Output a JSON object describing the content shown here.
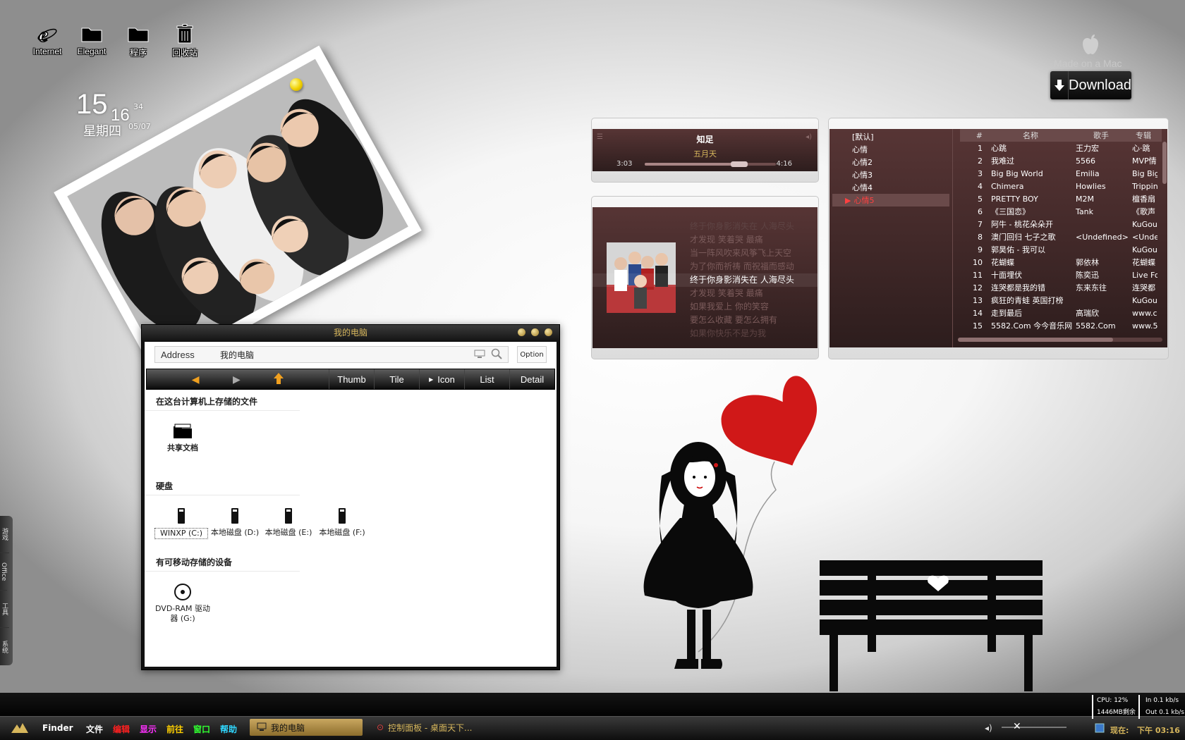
{
  "desktop": {
    "icons": [
      {
        "label": "Internet",
        "icon": "ie-icon"
      },
      {
        "label": "Elegant",
        "icon": "folder-icon"
      },
      {
        "label": "程序",
        "icon": "folder-icon"
      },
      {
        "label": "回收站",
        "icon": "recycle-bin-icon"
      }
    ]
  },
  "clock": {
    "hour": "15",
    "minute": "16",
    "second": "34",
    "weekday": "星期四",
    "date": "05/07"
  },
  "mac_badge": {
    "text": "Made on a Mac",
    "icon": "apple-icon"
  },
  "download": {
    "label": "Download",
    "icon": "download-arrow-icon"
  },
  "explorer": {
    "title": "我的电脑",
    "address_label": "Address",
    "address_value": "我的电脑",
    "option_label": "Option",
    "views": [
      "Thumb",
      "Tile",
      "Icon",
      "List",
      "Detail"
    ],
    "sections": [
      {
        "title": "在这台计算机上存储的文件",
        "items": [
          {
            "label": "共享文档",
            "icon": "folder-icon"
          }
        ]
      },
      {
        "title": "硬盘",
        "items": [
          {
            "label": "WINXP (C:)",
            "icon": "hard-disk-icon"
          },
          {
            "label": "本地磁盘 (D:)",
            "icon": "hard-disk-icon"
          },
          {
            "label": "本地磁盘 (E:)",
            "icon": "hard-disk-icon"
          },
          {
            "label": "本地磁盘 (F:)",
            "icon": "hard-disk-icon"
          }
        ]
      },
      {
        "title": "有可移动存储的设备",
        "items": [
          {
            "label": "DVD-RAM 驱动器 (G:)",
            "icon": "dvd-drive-icon"
          }
        ]
      }
    ]
  },
  "player": {
    "song": "知足",
    "artist": "五月天",
    "elapsed": "3:03",
    "total": "4:16",
    "progress": 0.72,
    "lyrics": [
      "终于你身影消失在  人海尽头",
      "才发现  笑着哭  最痛",
      "当一阵风吹来风筝飞上天空",
      "为了你而祈祷  而祝福而感动",
      "终于你身影消失在  人海尽头",
      "才发现  笑着哭  最痛",
      "如果我爱上  你的笑容",
      "要怎么收藏  要怎么拥有",
      "如果你快乐不是为我"
    ],
    "current_lyric_index": 4
  },
  "playlist": {
    "groups": [
      "[默认]",
      "心情",
      "心情2",
      "心情3",
      "心情4",
      "心情5"
    ],
    "active_group": 5,
    "columns": [
      "#",
      "名称",
      "歌手",
      "专辑"
    ],
    "rows": [
      [
        "1",
        "心跳",
        "王力宏",
        "心·跳"
      ],
      [
        "2",
        "我难过",
        "5566",
        "MVP情"
      ],
      [
        "3",
        "Big Big World",
        "Emilia",
        "Big Big"
      ],
      [
        "4",
        "Chimera",
        "Howlies",
        "Trippin"
      ],
      [
        "5",
        "PRETTY BOY",
        "M2M",
        "檀香扇"
      ],
      [
        "6",
        "《三国恋》",
        "Tank",
        "《歌声"
      ],
      [
        "7",
        "阿牛 - 桃花朵朵开",
        "",
        "KuGou"
      ],
      [
        "8",
        "澳门回归 七子之歌",
        "<Undefined>",
        "<Unde"
      ],
      [
        "9",
        "郭昊佑 - 我可以",
        "",
        "KuGou"
      ],
      [
        "10",
        "花蝴蝶",
        "郭依林",
        "花蝴蝶"
      ],
      [
        "11",
        "十面埋伏",
        "陈奕迅",
        "Live Fo"
      ],
      [
        "12",
        "连哭都是我的错",
        "东来东往",
        "连哭都"
      ],
      [
        "13",
        "疯狂的青蛙 英国打榜",
        "",
        "KuGou"
      ],
      [
        "14",
        "走到最后",
        "高瑞欣",
        "www.c"
      ],
      [
        "15",
        "5582.Com 今今音乐网",
        "5582.Com",
        "www.5"
      ]
    ]
  },
  "sidedock": [
    "游戏",
    "Office",
    "工具",
    "系统"
  ],
  "taskbar": {
    "menus": [
      {
        "label": "Finder",
        "color": "#ffffff"
      },
      {
        "label": "文件",
        "color": "#ffffff"
      },
      {
        "label": "编辑",
        "color": "#ff2020"
      },
      {
        "label": "显示",
        "color": "#ff30ff"
      },
      {
        "label": "前往",
        "color": "#ffd000"
      },
      {
        "label": "窗口",
        "color": "#30ff30"
      },
      {
        "label": "帮助",
        "color": "#30d8ff"
      }
    ],
    "tasks": [
      {
        "label": "我的电脑",
        "icon": "computer-icon",
        "active": true
      },
      {
        "label": "控制面板 - 桌面天下...",
        "icon": "control-panel-icon",
        "active": false
      }
    ],
    "cpu": "CPU: 12%",
    "memory": "1446MB剩余",
    "net_in": "In  0.1 kb/s",
    "net_out": "Out 0.1 kb/s",
    "time_label": "现在:",
    "time": "下午 03:16"
  },
  "colors": {
    "accent": "#d6b65c",
    "player_bg": "#4a2e2e",
    "heart": "#d01818"
  }
}
